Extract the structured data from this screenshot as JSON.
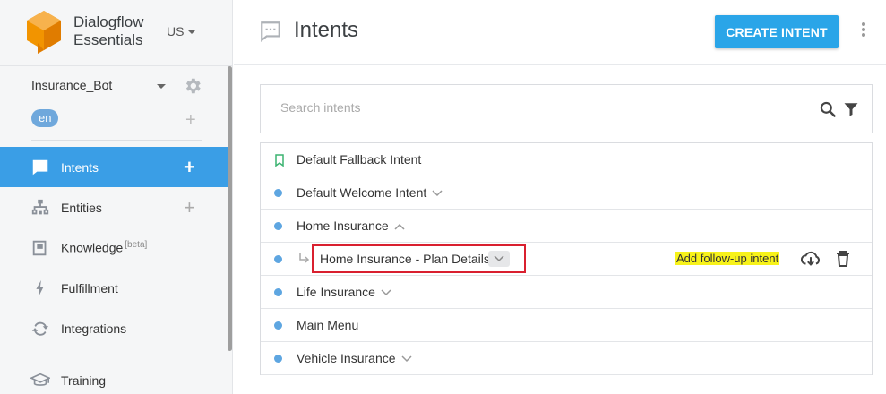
{
  "brand": {
    "line1": "Dialogflow",
    "line2": "Essentials",
    "region": "US"
  },
  "agent": {
    "name": "Insurance_Bot",
    "language": "en"
  },
  "nav": [
    {
      "label": "Intents",
      "icon": "intents-icon",
      "active": true,
      "plus": true
    },
    {
      "label": "Entities",
      "icon": "entities-icon",
      "active": false,
      "plus": true
    },
    {
      "label": "Knowledge",
      "beta": "[beta]",
      "icon": "knowledge-icon",
      "active": false
    },
    {
      "label": "Fulfillment",
      "icon": "bolt-icon",
      "active": false
    },
    {
      "label": "Integrations",
      "icon": "integrations-icon",
      "active": false
    },
    {
      "label": "Training",
      "icon": "training-icon",
      "active": false
    }
  ],
  "header": {
    "title": "Intents",
    "create_label": "CREATE INTENT"
  },
  "search": {
    "placeholder": "Search intents"
  },
  "intents": [
    {
      "name": "Default Fallback Intent"
    },
    {
      "name": "Default Welcome Intent"
    },
    {
      "name": "Home Insurance"
    },
    {
      "name": "Home Insurance - Plan Details",
      "followup_label": "Add follow-up intent"
    },
    {
      "name": "Life Insurance"
    },
    {
      "name": "Main Menu"
    },
    {
      "name": "Vehicle Insurance"
    }
  ],
  "colors": {
    "accent": "#3a9ee6",
    "button": "#2aa5e8",
    "highlight": "#f7f21a",
    "selection_border": "#d9202f",
    "logo": "#f29400"
  }
}
